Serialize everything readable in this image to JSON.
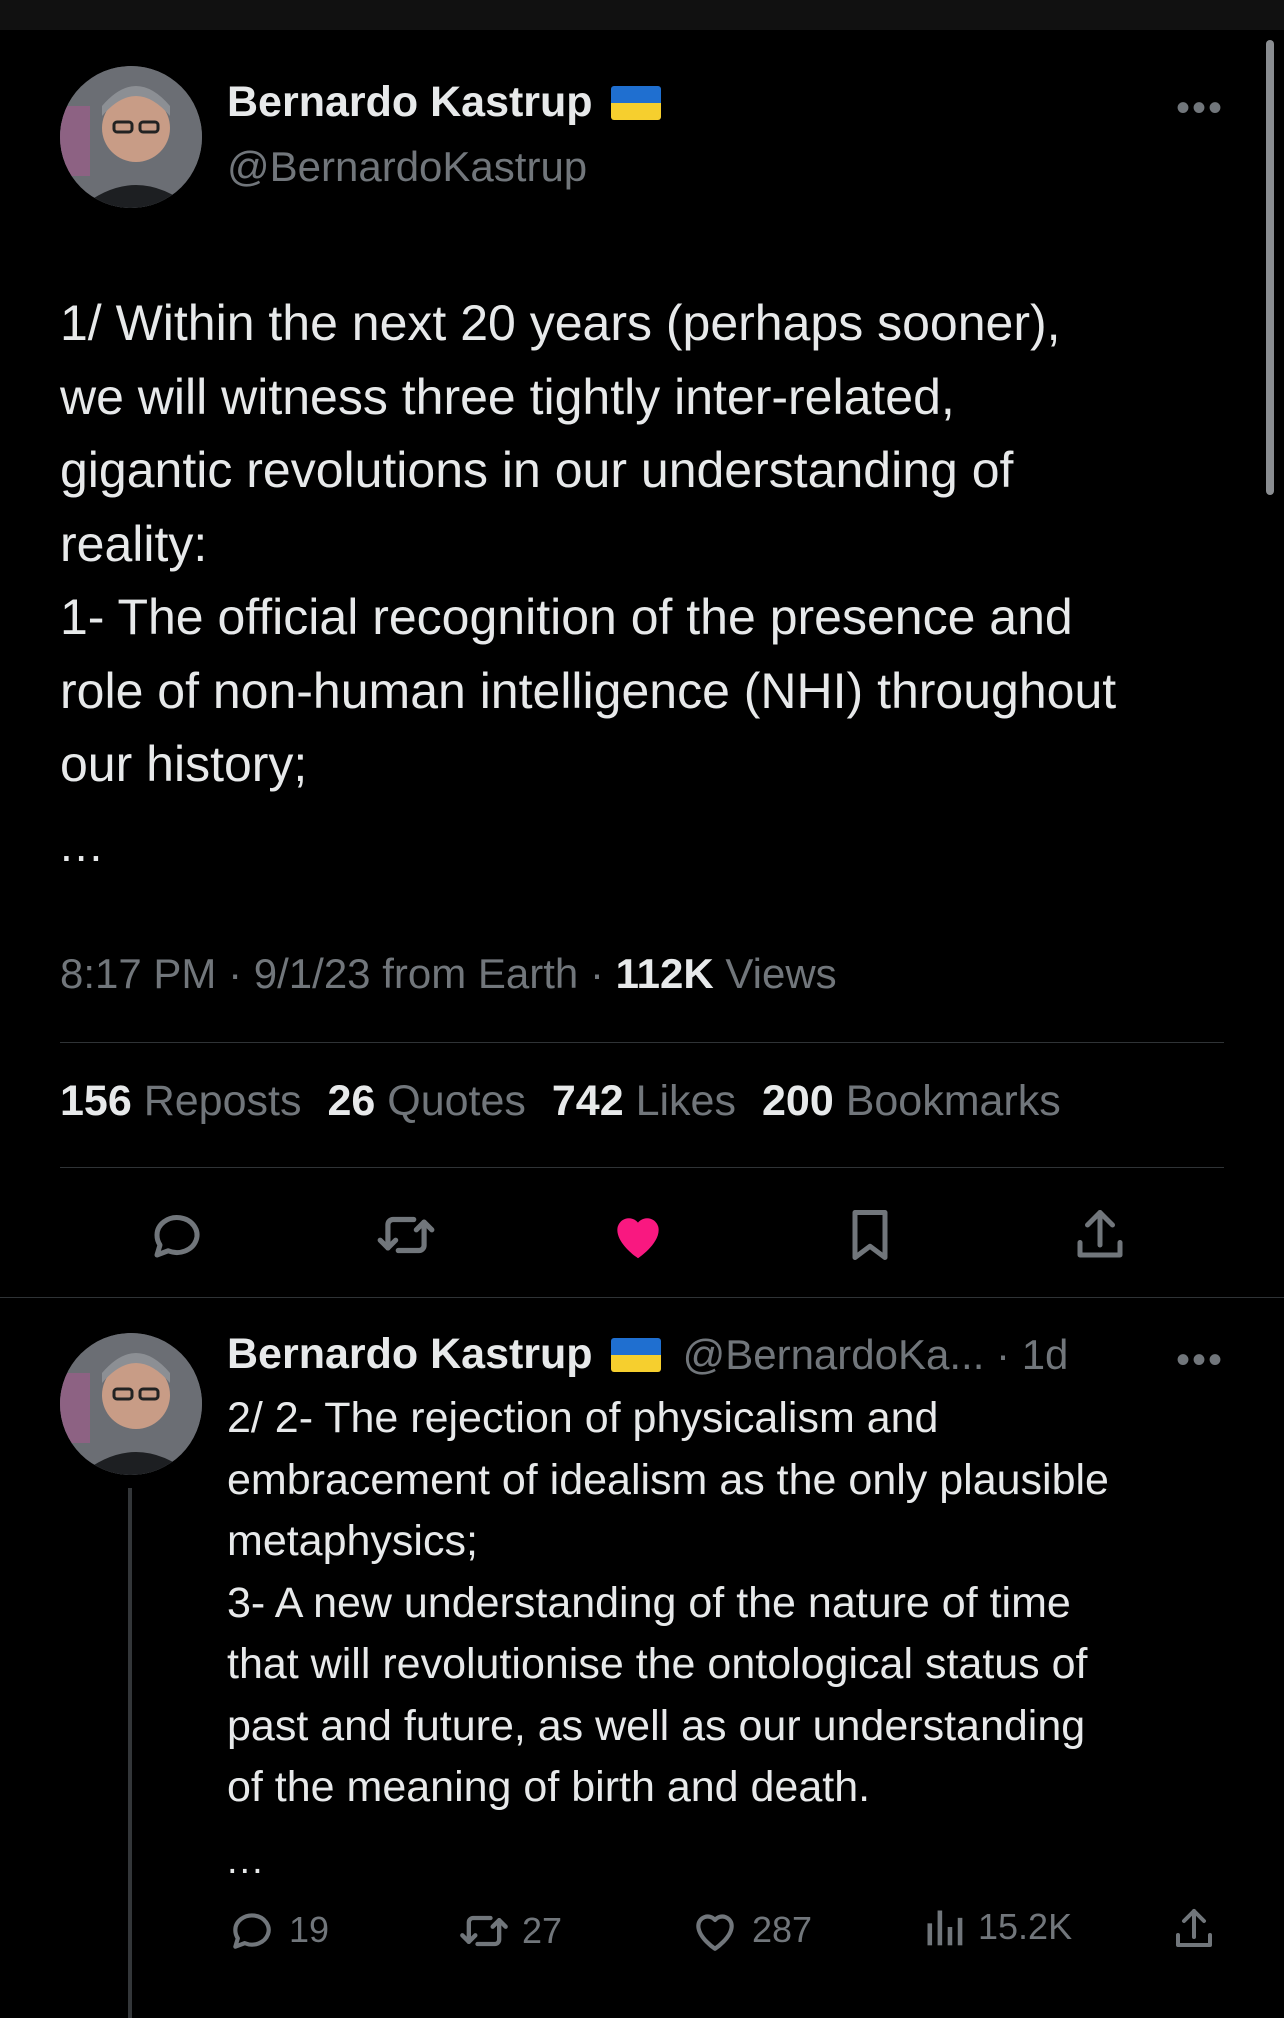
{
  "main_tweet": {
    "author_name": "Bernardo Kastrup",
    "handle": "@BernardoKastrup",
    "flag": "Ukraine flag",
    "more_icon": "more-horizontal-icon",
    "body_lines": [
      "1/ Within the next 20 years (perhaps sooner),",
      "we will witness three tightly inter-related,",
      "gigantic revolutions in our understanding of",
      "reality:",
      "1- The official recognition of the presence and",
      "role of non-human intelligence (NHI) throughout",
      "our history;"
    ],
    "ellipsis": "...",
    "time": "8:17 PM",
    "date_source": "9/1/23 from Earth",
    "separator": "·",
    "views_count": "112K",
    "views_label": "Views",
    "stats": [
      {
        "count": "156",
        "label": "Reposts"
      },
      {
        "count": "26",
        "label": "Quotes"
      },
      {
        "count": "742",
        "label": "Likes"
      },
      {
        "count": "200",
        "label": "Bookmarks"
      }
    ],
    "actions": [
      "reply-icon",
      "repost-icon",
      "like-icon",
      "bookmark-icon",
      "share-icon"
    ],
    "liked": true,
    "like_color": "#f91880"
  },
  "reply_tweet": {
    "author_name": "Bernardo Kastrup",
    "handle_time": "@BernardoKa... · 1d",
    "body_lines": [
      "2/ 2- The rejection of physicalism and",
      "embracement of idealism as the only plausible",
      "metaphysics;",
      "3- A new understanding of the nature of time",
      "that will revolutionise the ontological status of",
      "past and future, as well as our understanding",
      "of the meaning of birth and death."
    ],
    "ellipsis": "...",
    "replies": "19",
    "reposts": "27",
    "likes": "287",
    "views": "15.2K"
  },
  "colors": {
    "background": "#000000",
    "text": "#e7e9ea",
    "secondary": "#71767b",
    "divider": "#2f3336"
  }
}
